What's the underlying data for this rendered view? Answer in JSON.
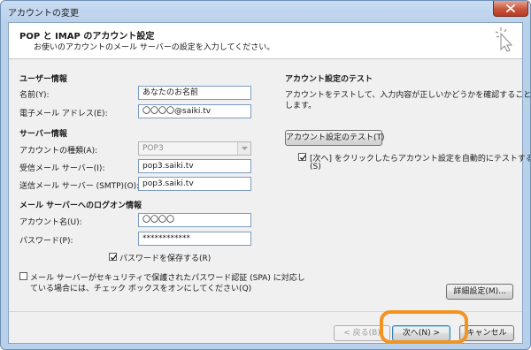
{
  "window": {
    "title": "アカウントの変更"
  },
  "header": {
    "title": "POP と IMAP のアカウント設定",
    "subtitle": "お使いのアカウントのメール サーバーの設定を入力してください。"
  },
  "user_info": {
    "section": "ユーザー情報",
    "name_label": "名前(Y):",
    "name_value": "あなたのお名前",
    "email_label": "電子メール アドレス(E):",
    "email_value": "〇〇〇〇@saiki.tv"
  },
  "server_info": {
    "section": "サーバー情報",
    "account_type_label": "アカウントの種類(A):",
    "account_type_value": "POP3",
    "incoming_label": "受信メール サーバー(I):",
    "incoming_value": "pop3.saiki.tv",
    "outgoing_label": "送信メール サーバー (SMTP)(O):",
    "outgoing_value": "pop3.saiki.tv"
  },
  "logon_info": {
    "section": "メール サーバーへのログオン情報",
    "account_name_label": "アカウント名(U):",
    "account_name_value": "〇〇〇〇",
    "password_label": "パスワード(P):",
    "password_value": "************",
    "save_password_label": "パスワードを保存する(R)",
    "save_password_checked": true,
    "spa_label_line1": "メール サーバーがセキュリティで保護されたパスワード認証 (SPA) に対応し",
    "spa_label_line2": "ている場合には、チェック ボックスをオンにしてください(Q)",
    "spa_checked": false
  },
  "test": {
    "section": "アカウント設定のテスト",
    "desc_line1": "アカウントをテストして、入力内容が正しいかどうかを確認することをお勧め",
    "desc_line2": "します。",
    "test_button": "アカウント設定のテスト(T)",
    "auto_test_line1": "[次へ] をクリックしたらアカウント設定を自動的にテストする",
    "auto_test_line2": "(S)",
    "auto_test_checked": true
  },
  "buttons": {
    "more_settings": "詳細設定(M)...",
    "back": "< 戻る(B)",
    "next": "次へ(N) >",
    "cancel": "キャンセル"
  },
  "colors": {
    "highlight": "#f39322",
    "close": "#c8563d"
  }
}
